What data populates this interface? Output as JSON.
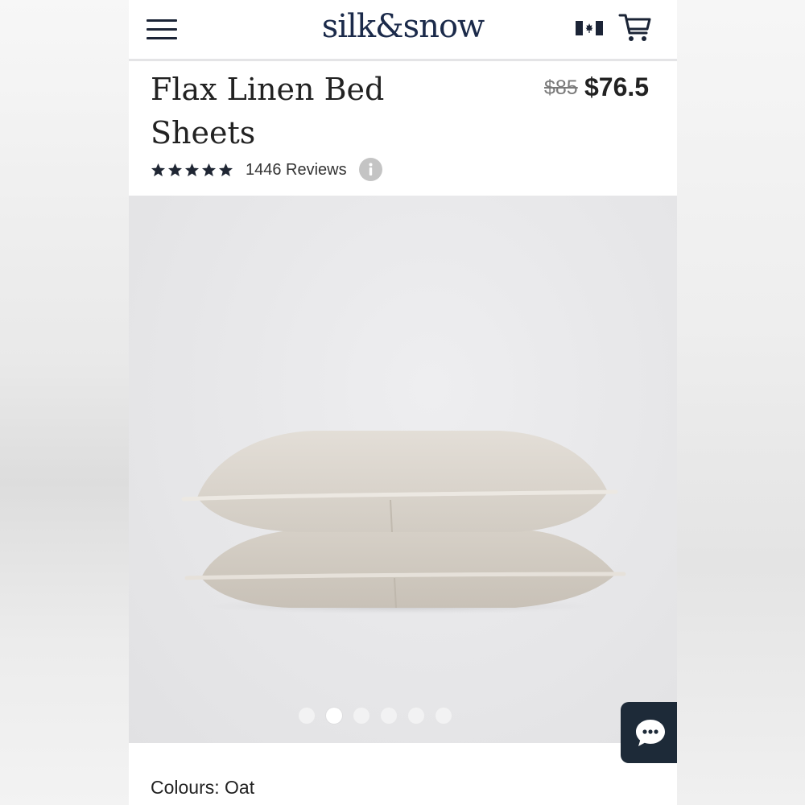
{
  "header": {
    "logo_text": "silk&snow",
    "menu_icon": "hamburger-menu-icon",
    "flag_icon": "canada-flag-icon",
    "cart_icon": "shopping-cart-icon"
  },
  "product": {
    "title": "Flax Linen Bed Sheets",
    "price_original": "$85",
    "price_sale": "$76.5",
    "rating_stars": 5,
    "reviews_text": "1446 Reviews",
    "info_icon": "info-icon"
  },
  "gallery": {
    "image_subject": "two stacked oat linen pillows",
    "slide_count": 6,
    "active_slide": 2
  },
  "chat": {
    "icon": "chat-bubble-icon"
  },
  "options": {
    "colours_text": "Colours: Oat"
  },
  "colors": {
    "navy": "#1b2a4a",
    "chat_bg": "#1d2a38",
    "text": "#222222",
    "pillow": "#d9d4cc"
  }
}
